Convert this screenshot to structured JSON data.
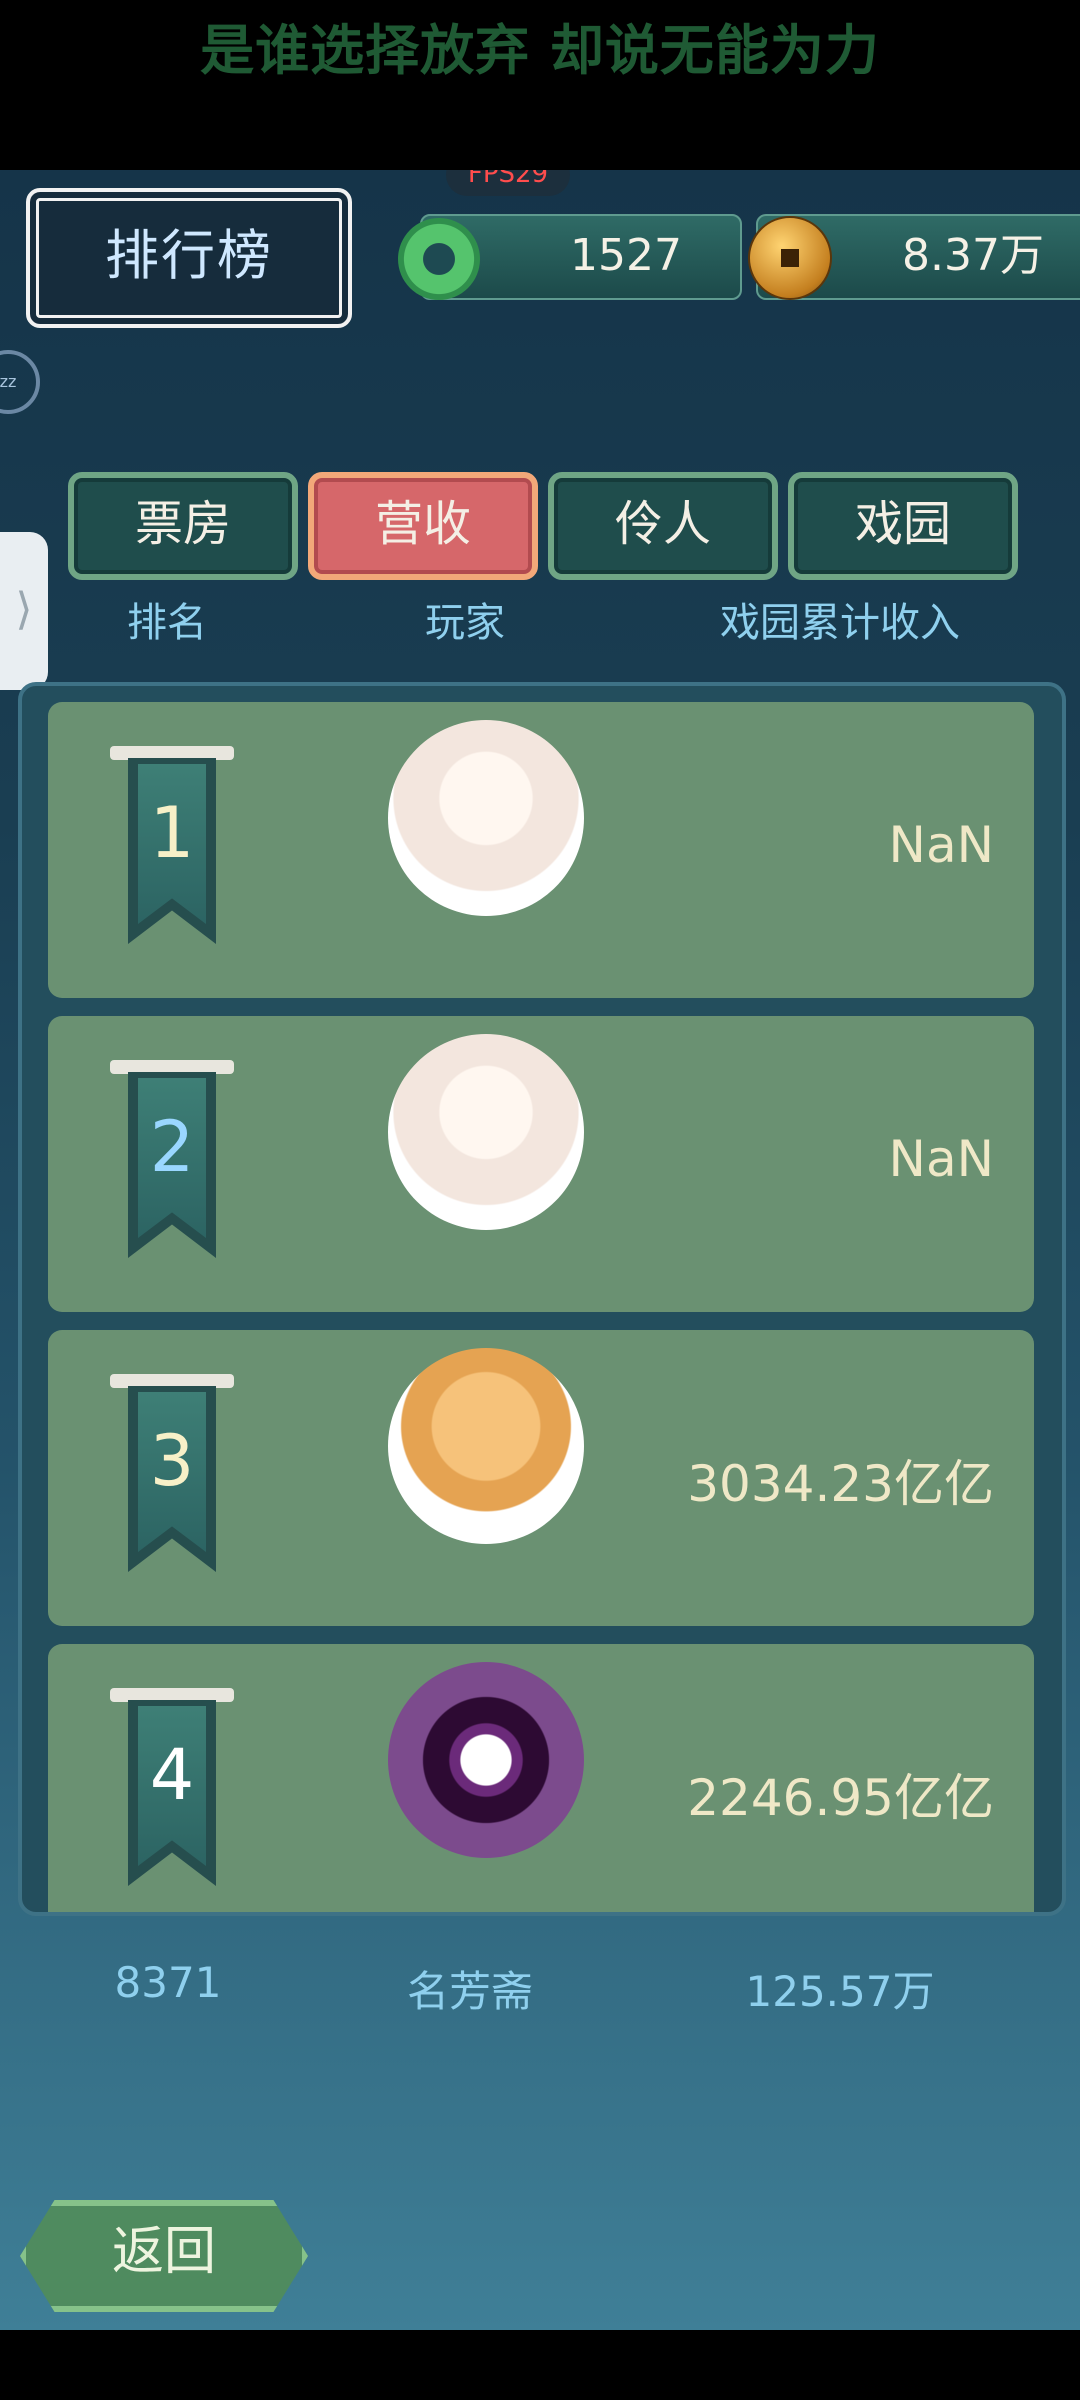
{
  "status_text": "是谁选择放弃 却说无能为力",
  "fps_label": "FPS29",
  "screen_title": "排行榜",
  "currency": {
    "jade": "1527",
    "coins": "8.37万"
  },
  "tabs": [
    {
      "label": "票房"
    },
    {
      "label": "营收",
      "active": true
    },
    {
      "label": "伶人"
    },
    {
      "label": "戏园"
    }
  ],
  "table_header": {
    "rank": "排名",
    "player": "玩家",
    "income": "戏园累计收入"
  },
  "rows": [
    {
      "rank": "1",
      "avatar": "anime-girl-avatar",
      "income": "NaN"
    },
    {
      "rank": "2",
      "avatar": "anime-girl-avatar",
      "income": "NaN"
    },
    {
      "rank": "3",
      "avatar": "shiba-dog-avatar",
      "income": "3034.23亿亿"
    },
    {
      "rank": "4",
      "avatar": "purple-eye-avatar",
      "income": "2246.95亿亿"
    }
  ],
  "self_row": {
    "rank": "8371",
    "name": "名芳斋",
    "income": "125.57万"
  },
  "back_label": "返回",
  "side_tab_glyph": "⟩"
}
